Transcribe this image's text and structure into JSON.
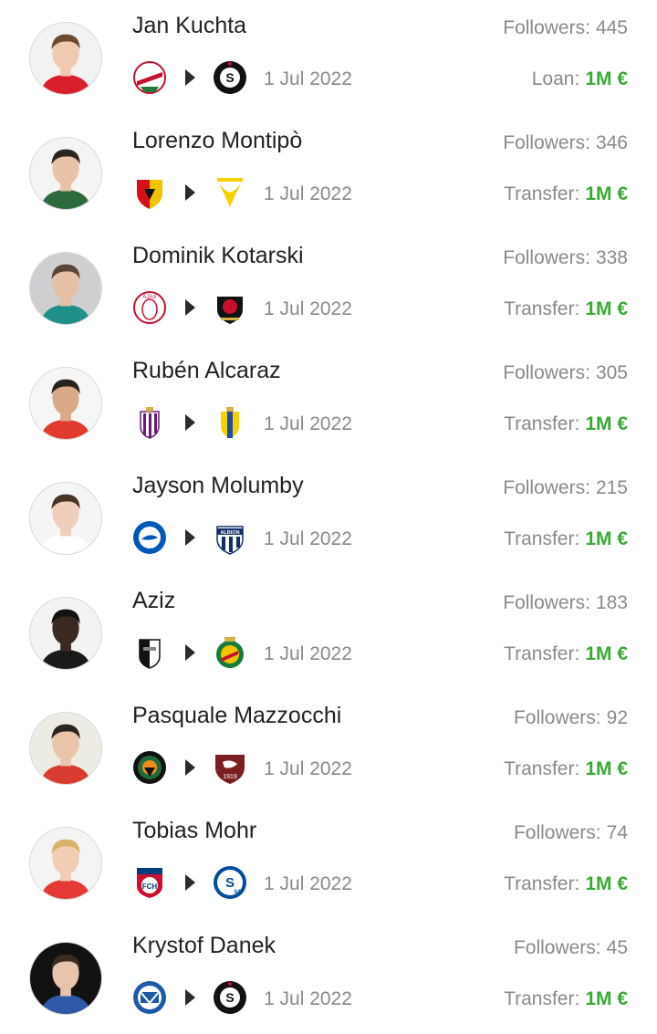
{
  "rows": [
    {
      "player": "Jan Kuchta",
      "followers_label": "Followers:",
      "followers": "445",
      "from_club": "lokomotiv-crest-icon",
      "to_club": "sparta-praha-crest-icon",
      "date": "1 Jul 2022",
      "type_label": "Loan:",
      "amount": "1M €",
      "photo_bg": "#f2f2f2",
      "skin": "#efc9b0",
      "hair": "#6b4a2f",
      "shirt": "#d81e2a"
    },
    {
      "player": "Lorenzo Montipò",
      "followers_label": "Followers:",
      "followers": "346",
      "from_club": "benevento-crest-icon",
      "to_club": "verona-crest-icon",
      "date": "1 Jul 2022",
      "type_label": "Transfer:",
      "amount": "1M €",
      "photo_bg": "#f4f4f4",
      "skin": "#e8c2a6",
      "hair": "#2b2520",
      "shirt": "#2d6b3c"
    },
    {
      "player": "Dominik Kotarski",
      "followers_label": "Followers:",
      "followers": "338",
      "from_club": "ajax-crest-icon",
      "to_club": "paok-crest-icon",
      "date": "1 Jul 2022",
      "type_label": "Transfer:",
      "amount": "1M €",
      "photo_bg": "#cfcfd2",
      "skin": "#e6c0a4",
      "hair": "#5a4536",
      "shirt": "#1f8f8a"
    },
    {
      "player": "Rubén Alcaraz",
      "followers_label": "Followers:",
      "followers": "305",
      "from_club": "valladolid-crest-icon",
      "to_club": "cadiz-crest-icon",
      "date": "1 Jul 2022",
      "type_label": "Transfer:",
      "amount": "1M €",
      "photo_bg": "#f6f6f6",
      "skin": "#d9a988",
      "hair": "#2a221d",
      "shirt": "#e03a2f"
    },
    {
      "player": "Jayson Molumby",
      "followers_label": "Followers:",
      "followers": "215",
      "from_club": "brighton-crest-icon",
      "to_club": "west-brom-crest-icon",
      "date": "1 Jul 2022",
      "type_label": "Transfer:",
      "amount": "1M €",
      "photo_bg": "#f5f5f5",
      "skin": "#efcfbb",
      "hair": "#4a3426",
      "shirt": "#ffffff"
    },
    {
      "player": "Aziz",
      "followers_label": "Followers:",
      "followers": "183",
      "from_club": "guimaraes-crest-icon",
      "to_club": "rio-ave-crest-icon",
      "date": "1 Jul 2022",
      "type_label": "Transfer:",
      "amount": "1M €",
      "photo_bg": "#f3f3f3",
      "skin": "#3b2a22",
      "hair": "#111111",
      "shirt": "#1a1a1a"
    },
    {
      "player": "Pasquale Mazzocchi",
      "followers_label": "Followers:",
      "followers": "92",
      "from_club": "venezia-crest-icon",
      "to_club": "salernitana-crest-icon",
      "date": "1 Jul 2022",
      "type_label": "Transfer:",
      "amount": "1M €",
      "photo_bg": "#ecebe4",
      "skin": "#e9c4a8",
      "hair": "#2b2520",
      "shirt": "#d83b30"
    },
    {
      "player": "Tobias Mohr",
      "followers_label": "Followers:",
      "followers": "74",
      "from_club": "heidenheim-crest-icon",
      "to_club": "schalke-crest-icon",
      "date": "1 Jul 2022",
      "type_label": "Transfer:",
      "amount": "1M €",
      "photo_bg": "#f4f4f4",
      "skin": "#f1cdb4",
      "hair": "#d9b26a",
      "shirt": "#e33a36"
    },
    {
      "player": "Krystof Danek",
      "followers_label": "Followers:",
      "followers": "45",
      "from_club": "sigma-olomouc-crest-icon",
      "to_club": "sparta-praha-crest-icon",
      "date": "1 Jul 2022",
      "type_label": "Transfer:",
      "amount": "1M €",
      "photo_bg": "#111111",
      "skin": "#e8c4ac",
      "hair": "#3b2c22",
      "shirt": "#2d59a8"
    }
  ]
}
